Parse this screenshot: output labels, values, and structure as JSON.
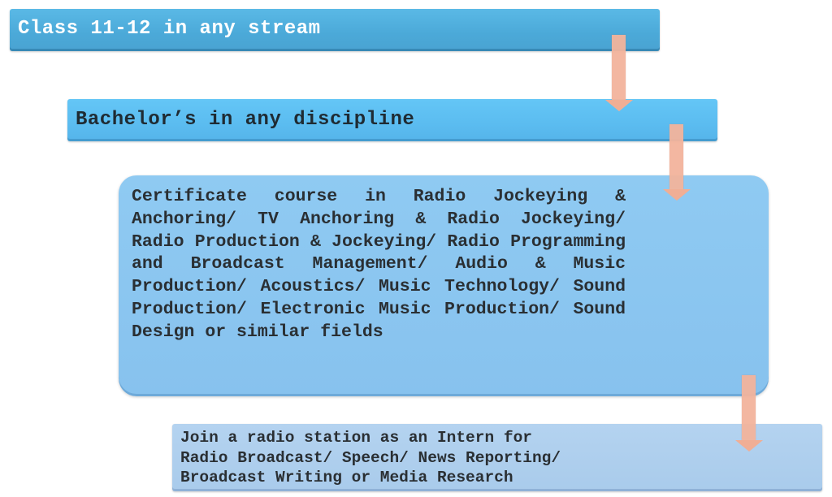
{
  "diagram": {
    "type": "career-path-flowchart",
    "steps": [
      {
        "id": "step-1",
        "label": "Class 11-12 in any stream",
        "color": "#4aa8d8"
      },
      {
        "id": "step-2",
        "label": "Bachelor’s in any discipline",
        "color": "#5bbcf0"
      },
      {
        "id": "step-3",
        "label": "Certificate course in Radio Jockeying & Anchoring/ TV Anchoring & Radio Jockeying/ Radio Production & Jockeying/ Radio Programming and Broadcast Management/ Audio & Music Production/ Acoustics/ Music Technology/ Sound Production/ Electronic Music Production/ Sound Design or similar fields",
        "color": "#8ac4ef"
      },
      {
        "id": "step-4",
        "label": "Join a radio station as an Intern for Radio Broadcast/ Speech/ News Reporting/ Broadcast Writing or Media Research",
        "lines": [
          "Join a radio station as an Intern for",
          "Radio Broadcast/ Speech/ News Reporting/",
          "Broadcast Writing or Media Research"
        ],
        "color": "#add0ee"
      }
    ],
    "connectors": [
      {
        "from": "step-1",
        "to": "step-2",
        "icon": "arrow-down-icon",
        "color": "#f3b49c"
      },
      {
        "from": "step-2",
        "to": "step-3",
        "icon": "arrow-down-icon",
        "color": "#f3b49c"
      },
      {
        "from": "step-3",
        "to": "step-4",
        "icon": "arrow-down-icon",
        "color": "#f3b49c"
      }
    ]
  }
}
